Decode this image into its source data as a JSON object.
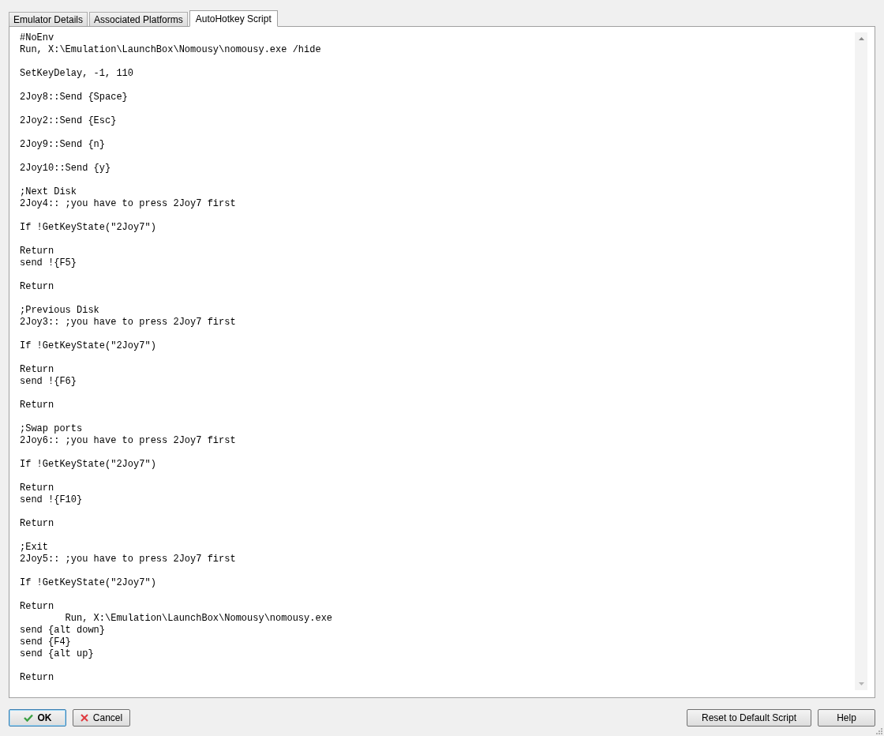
{
  "tabs": [
    {
      "label": "Emulator Details",
      "selected": false
    },
    {
      "label": "Associated Platforms",
      "selected": false
    },
    {
      "label": "AutoHotkey Script",
      "selected": true
    }
  ],
  "script": {
    "text": "#NoEnv\nRun, X:\\Emulation\\LaunchBox\\Nomousy\\nomousy.exe /hide\n\nSetKeyDelay, -1, 110\n\n2Joy8::Send {Space}\n\n2Joy2::Send {Esc}\n\n2Joy9::Send {n}\n\n2Joy10::Send {y}\n\n;Next Disk\n2Joy4:: ;you have to press 2Joy7 first\n\nIf !GetKeyState(\"2Joy7\")\n\nReturn\nsend !{F5}\n\nReturn\n\n;Previous Disk\n2Joy3:: ;you have to press 2Joy7 first\n\nIf !GetKeyState(\"2Joy7\")\n\nReturn\nsend !{F6}\n\nReturn\n\n;Swap ports\n2Joy6:: ;you have to press 2Joy7 first\n\nIf !GetKeyState(\"2Joy7\")\n\nReturn\nsend !{F10}\n\nReturn\n\n;Exit\n2Joy5:: ;you have to press 2Joy7 first\n\nIf !GetKeyState(\"2Joy7\")\n\nReturn\n        Run, X:\\Emulation\\LaunchBox\\Nomousy\\nomousy.exe\nsend {alt down}\nsend {F4}\nsend {alt up}\n\nReturn"
  },
  "buttons": [
    {
      "kind": "ok",
      "label": "OK",
      "focused": true
    },
    {
      "kind": "cancel",
      "label": "Cancel",
      "focused": false
    },
    {
      "kind": "plain",
      "label": "Reset to Default Script",
      "focused": false
    },
    {
      "kind": "plain",
      "label": "Help",
      "focused": false
    }
  ]
}
